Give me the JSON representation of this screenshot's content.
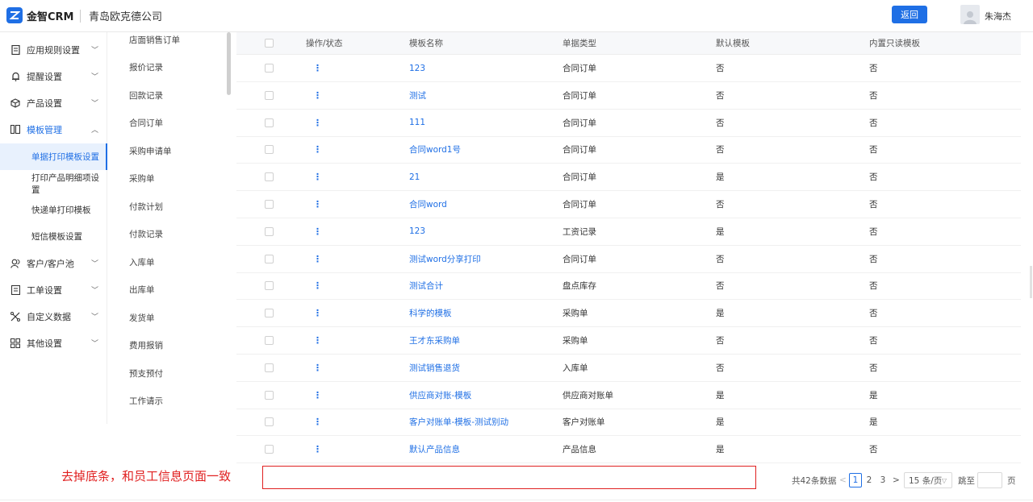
{
  "header": {
    "brand": "金智CRM",
    "company": "青岛欧克德公司",
    "back_label": "返回",
    "username": "朱海杰"
  },
  "sidebar": {
    "items": [
      {
        "label": "应用规则设置",
        "icon": "document-icon"
      },
      {
        "label": "提醒设置",
        "icon": "bell-icon"
      },
      {
        "label": "产品设置",
        "icon": "cube-icon"
      },
      {
        "label": "模板管理",
        "icon": "template-icon"
      },
      {
        "label": "客户/客户池",
        "icon": "customer-icon"
      },
      {
        "label": "工单设置",
        "icon": "ticket-icon"
      },
      {
        "label": "自定义数据",
        "icon": "custom-data-icon"
      },
      {
        "label": "其他设置",
        "icon": "grid-icon"
      }
    ],
    "sub_items": [
      {
        "label": "单据打印模板设置"
      },
      {
        "label": "打印产品明细项设置"
      },
      {
        "label": "快递单打印模板"
      },
      {
        "label": "短信模板设置"
      }
    ]
  },
  "midlist": {
    "items": [
      "店面销售订单",
      "报价记录",
      "回款记录",
      "合同订单",
      "采购申请单",
      "采购单",
      "付款计划",
      "付款记录",
      "入库单",
      "出库单",
      "发货单",
      "费用报销",
      "预支预付",
      "工作请示"
    ]
  },
  "table": {
    "headers": {
      "ops": "操作/状态",
      "name": "模板名称",
      "type": "单据类型",
      "default": "默认模板",
      "readonly": "内置只读模板"
    },
    "rows": [
      {
        "name": "123",
        "type": "合同订单",
        "default": "否",
        "readonly": "否"
      },
      {
        "name": "测试",
        "type": "合同订单",
        "default": "否",
        "readonly": "否"
      },
      {
        "name": "111",
        "type": "合同订单",
        "default": "否",
        "readonly": "否"
      },
      {
        "name": "合同word1号",
        "type": "合同订单",
        "default": "否",
        "readonly": "否"
      },
      {
        "name": "21",
        "type": "合同订单",
        "default": "是",
        "readonly": "否"
      },
      {
        "name": "合同word",
        "type": "合同订单",
        "default": "否",
        "readonly": "否"
      },
      {
        "name": "123",
        "type": "工资记录",
        "default": "是",
        "readonly": "否"
      },
      {
        "name": "测试word分享打印",
        "type": "合同订单",
        "default": "否",
        "readonly": "否"
      },
      {
        "name": "测试合计",
        "type": "盘点库存",
        "default": "否",
        "readonly": "否"
      },
      {
        "name": "科学的模板",
        "type": "采购单",
        "default": "是",
        "readonly": "否"
      },
      {
        "name": "王才东采购单",
        "type": "采购单",
        "default": "否",
        "readonly": "否"
      },
      {
        "name": "测试销售退货",
        "type": "入库单",
        "default": "否",
        "readonly": "否"
      },
      {
        "name": "供应商对账-模板",
        "type": "供应商对账单",
        "default": "是",
        "readonly": "是"
      },
      {
        "name": "客户对账单-模板-测试别动",
        "type": "客户对账单",
        "default": "是",
        "readonly": "是"
      },
      {
        "name": "默认产品信息",
        "type": "产品信息",
        "default": "是",
        "readonly": "否"
      }
    ]
  },
  "annotation": {
    "text": "去掉底条，和员工信息页面一致"
  },
  "pagination": {
    "total": "共42条数据",
    "prev": "<",
    "pages": [
      "1",
      "2",
      "3"
    ],
    "next": ">",
    "page_size": "15 条/页",
    "goto_label": "跳至",
    "page_suffix": "页"
  },
  "colors": {
    "accent": "#1f6fe5",
    "annotation": "#e02020"
  }
}
